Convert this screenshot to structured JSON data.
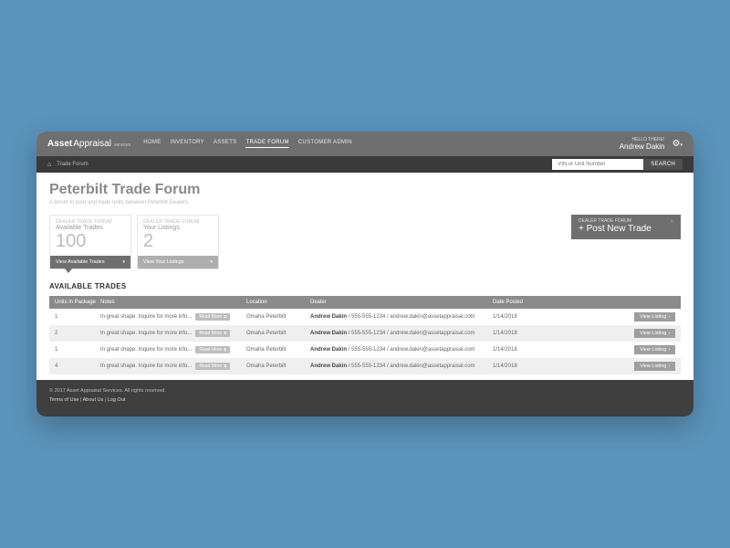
{
  "logo": {
    "bold": "Asset",
    "light": "Appraisal",
    "sub": "services"
  },
  "nav": [
    "HOME",
    "INVENTORY",
    "ASSETS",
    "TRADE FORUM",
    "CUSTOMER ADMIN"
  ],
  "nav_active_index": 3,
  "greeting": {
    "hello": "HELLO THERE!",
    "name": "Andrew Dakin"
  },
  "breadcrumb": "Trade Forum",
  "search": {
    "placeholder": "VIN or Unit Number",
    "button": "SEARCH"
  },
  "page": {
    "title": "Peterbilt Trade Forum",
    "subtitle": "A forum to post and trade units between Peterbilt Dealers."
  },
  "cards": {
    "available": {
      "eyebrow": "DEALER TRADE FORUM",
      "label": "Available Trades",
      "value": "100",
      "button": "View Available Trades"
    },
    "yours": {
      "eyebrow": "DEALER TRADE FORUM",
      "label": "Your Listings",
      "value": "2",
      "button": "View Your Listings"
    },
    "post": {
      "eyebrow": "DEALER TRADE FORUM",
      "label": "+ Post New Trade"
    }
  },
  "section_title": "AVAILABLE TRADES",
  "table": {
    "headers": [
      "Units in Package",
      "Notes",
      "Location",
      "Dealer",
      "Date Posted",
      ""
    ],
    "read_more": "Read More",
    "view_listing": "View Listing",
    "rows": [
      {
        "units": "1",
        "notes": "In great shape. Inquire for more info...",
        "location": "Omaha Peterbilt",
        "dealer_name": "Andrew Dakin",
        "dealer_rest": " / 555-555-1234 / andrew.dakin@assetappraisal.com",
        "date": "1/14/2018"
      },
      {
        "units": "2",
        "notes": "In great shape. Inquire for more info...",
        "location": "Omaha Peterbilt",
        "dealer_name": "Andrew Dakin",
        "dealer_rest": " / 555-555-1234 / andrew.dakin@assetappraisal.com",
        "date": "1/14/2018"
      },
      {
        "units": "1",
        "notes": "In great shape. Inquire for more info...",
        "location": "Omaha Peterbilt",
        "dealer_name": "Andrew Dakin",
        "dealer_rest": " / 555-555-1234 / andrew.dakin@assetappraisal.com",
        "date": "1/14/2018"
      },
      {
        "units": "4",
        "notes": "In great shape. Inquire for more info...",
        "location": "Omaha Peterbilt",
        "dealer_name": "Andrew Dakin",
        "dealer_rest": " / 555-555-1234 / andrew.dakin@assetappraisal.com",
        "date": "1/14/2018"
      }
    ]
  },
  "footer": {
    "copyright": "© 2017 Asset Appraisal Services. All rights reserved.",
    "links": [
      "Terms of Use",
      "About Us",
      "Log Out"
    ]
  }
}
